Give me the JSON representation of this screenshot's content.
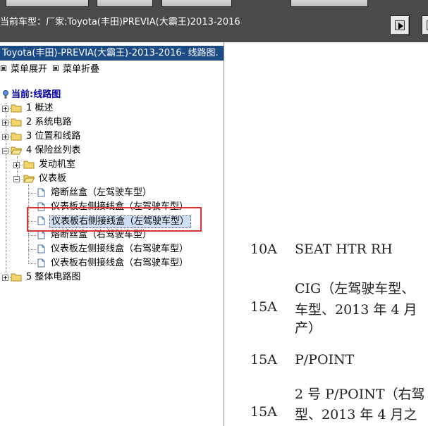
{
  "topbar": {
    "vehicle_prefix": "当前车型：",
    "vehicle_name": "厂家:Toyota(丰田)PREVIA(大霸王)2013-2016",
    "accent": "#4a4a4a"
  },
  "sidebar": {
    "title": "Toyota(丰田)-PREVIA(大霸王)-2013-2016- 线路图.",
    "expand_all": "菜单展开",
    "collapse_all": "菜单折叠",
    "root_label": "当前:线路图",
    "tree": {
      "n1": "1 概述",
      "n2": "2 系统电路",
      "n3": "3 位置和线路",
      "n4": "4 保险丝列表",
      "n4_1": "发动机室",
      "n4_2": "仪表板",
      "n4_2_1": "熔断丝盒（左驾驶车型）",
      "n4_2_2": "仪表板左侧接线盒（左驾驶车型）",
      "n4_2_3": "仪表板右侧接线盒（左驾驶车型）",
      "n4_2_4": "熔断丝盒（右驾驶车型）",
      "n4_2_5": "仪表板左侧接线盒（右驾驶车型）",
      "n4_2_6": "仪表板右侧接线盒（右驾驶车型）",
      "n5": "5 整体电路图"
    },
    "title_bg": "#1c4b86",
    "highlight_color": "#e03030"
  },
  "content": {
    "rows": [
      {
        "amp": "10A",
        "line1": "SEAT HTR RH"
      },
      {
        "amp": "",
        "line1": "CIG（左驾驶车型、"
      },
      {
        "amp": "15A",
        "line1": "车型、2013 年 4 月"
      },
      {
        "amp": "",
        "line1": "产）"
      },
      {
        "amp": "15A",
        "line1": "P/POINT"
      },
      {
        "amp": "",
        "line1": "2 号 P/POINT（右驾"
      },
      {
        "amp": "15A",
        "line1": "型、2013 年 4 月之"
      }
    ]
  }
}
